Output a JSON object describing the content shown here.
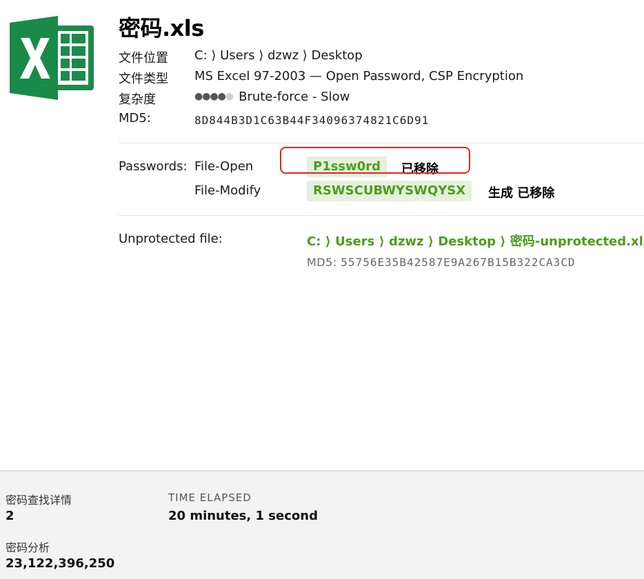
{
  "file": {
    "icon": "excel-icon",
    "name": "密码.xls",
    "location_label": "文件位置",
    "location": "C: ⟩ Users ⟩ dzwz ⟩ Desktop",
    "type_label": "文件类型",
    "type": "MS Excel 97-2003 — Open Password, CSP Encryption",
    "complexity_label": "复杂度",
    "complexity_level": 4,
    "complexity_max": 5,
    "complexity_text": "Brute-force - Slow",
    "md5_label": "MD5:",
    "md5": "8D844B3D1C63B44F34096374821C6D91"
  },
  "passwords": {
    "label": "Passwords:",
    "rows": [
      {
        "kind": "File-Open",
        "value": "P1ssw0rd",
        "status": "已移除"
      },
      {
        "kind": "File-Modify",
        "value": "RSWSCUBWYSWQYSX",
        "status": "生成 已移除"
      }
    ]
  },
  "unprotected": {
    "label": "Unprotected file:",
    "path": "C: ⟩ Users ⟩ dzwz ⟩ Desktop ⟩ 密码-unprotected.xls",
    "md5_prefix": "MD5:",
    "md5": "55756E35B42587E9A267B15B322CA3CD"
  },
  "stats": {
    "details_label": "密码查找详情",
    "details_value": "2",
    "elapsed_label": "TIME ELAPSED",
    "elapsed_value": "20 minutes, 1 second",
    "analysis_label": "密码分析",
    "analysis_value": "23,122,396,250"
  },
  "colors": {
    "accent_green": "#4b9d1b",
    "pill_bg": "#e5f1dc",
    "highlight_red": "#e0251c",
    "excel_green": "#1e8a4a"
  }
}
